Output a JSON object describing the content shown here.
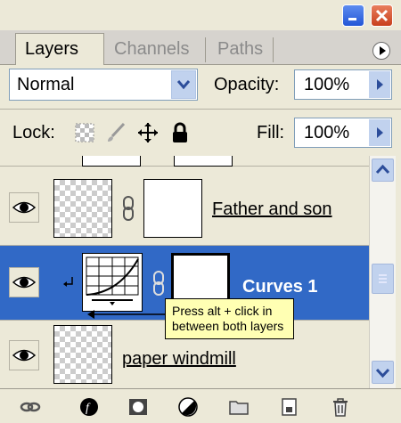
{
  "tabs": [
    {
      "label": "Layers",
      "active": true
    },
    {
      "label": "Channels",
      "active": false
    },
    {
      "label": "Paths",
      "active": false
    }
  ],
  "blend_mode": "Normal",
  "opacity": {
    "label": "Opacity:",
    "value": "100%"
  },
  "lock": {
    "label": "Lock:"
  },
  "fill": {
    "label": "Fill:",
    "value": "100%"
  },
  "layers": [
    {
      "name": "Father and son",
      "selected": false
    },
    {
      "name": "Curves 1",
      "selected": true
    },
    {
      "name": "paper windmill",
      "selected": false
    }
  ],
  "tooltip": {
    "text": "Press alt + click in between both layers"
  },
  "icons": [
    "minimize-icon",
    "close-icon",
    "panel-menu-icon",
    "dropdown-arrow-icon",
    "lock-transparent-icon",
    "lock-brush-icon",
    "lock-move-icon",
    "lock-all-icon",
    "eye-icon",
    "link-chain-icon",
    "curves-icon",
    "link-layers-icon",
    "layer-style-icon",
    "mask-icon",
    "adjustment-layer-icon",
    "folder-icon",
    "new-layer-icon",
    "trash-icon"
  ],
  "colors": {
    "selection": "#3169c6",
    "tooltip_bg": "#ffffb3",
    "panel_bg": "#ece9d8"
  }
}
